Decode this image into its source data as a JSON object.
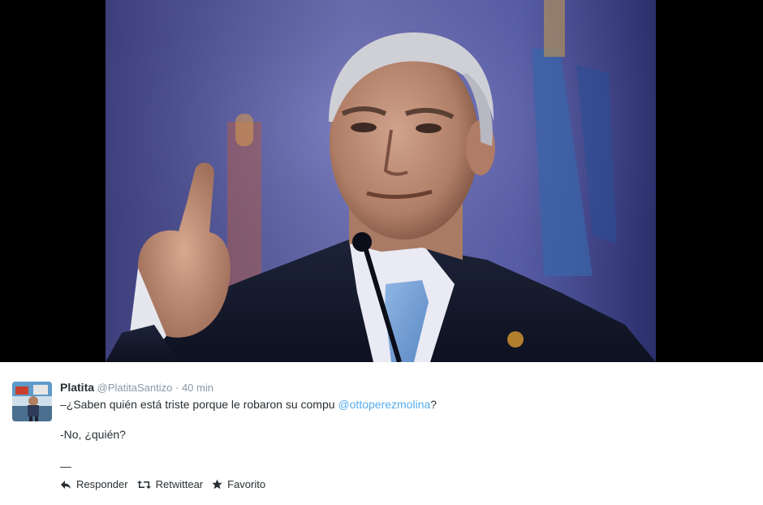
{
  "tweet": {
    "author": {
      "display_name": "Platita",
      "screen_name": "@PlatitaSantizo"
    },
    "separator": "·",
    "timestamp": "40 min",
    "text": {
      "line1_prefix": "–¿Saben quién está triste porque le robaron su compu ",
      "mention": "@ottoperezmolina",
      "line1_suffix": "?",
      "line2": "-No, ¿quién?",
      "line3": "—"
    },
    "actions": {
      "reply_label": "Responder",
      "retweet_label": "Retwittear",
      "favorite_label": "Favorito"
    },
    "icons": [
      "reply-icon",
      "retweet-icon",
      "star-icon"
    ]
  },
  "colors": {
    "link": "#55acee",
    "muted": "#8899a6",
    "text": "#292f33"
  }
}
